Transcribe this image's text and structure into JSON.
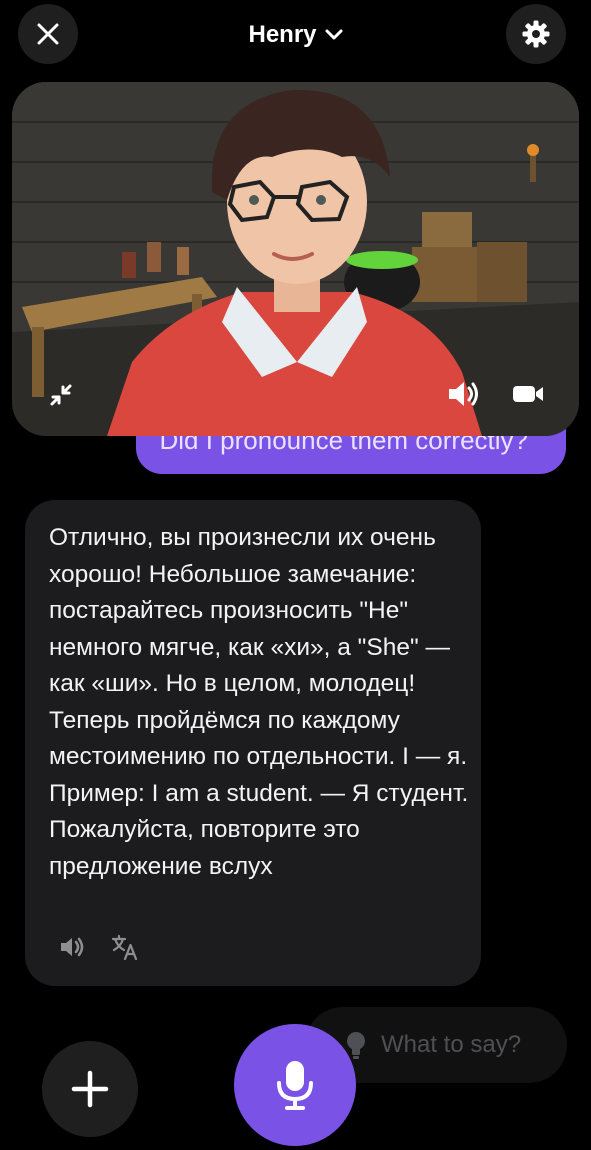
{
  "header": {
    "title": "Henry",
    "close_icon": "close-icon",
    "chevron_icon": "chevron-down-icon",
    "settings_icon": "gear-icon"
  },
  "video": {
    "collapse_icon": "minimize-icon",
    "sound_icon": "speaker-icon",
    "camera_icon": "video-camera-icon"
  },
  "user_message": {
    "text": "Did I pronounce them correctly?"
  },
  "assistant_message": {
    "text": "Отлично, вы произнесли их очень хорошо! Небольшое замечание: постарайтесь произносить \"He\" немного мягче, как «хи», а \"She\" — как «ши». Но в целом, молодец! Теперь пройдёмся по каждому местоимению по отдельности. I — я. Пример: I am a student. — Я студент. Пожалуйста, повторите это предложение вслух",
    "play_icon": "speaker-icon",
    "translate_icon": "translate-icon"
  },
  "bottom": {
    "suggest_label": "What to say?",
    "suggest_icon": "lightbulb-icon",
    "add_icon": "plus-icon",
    "mic_icon": "microphone-icon"
  },
  "colors": {
    "accent": "#7b52e6",
    "background": "#000000",
    "bubble": "#1c1c1e"
  }
}
